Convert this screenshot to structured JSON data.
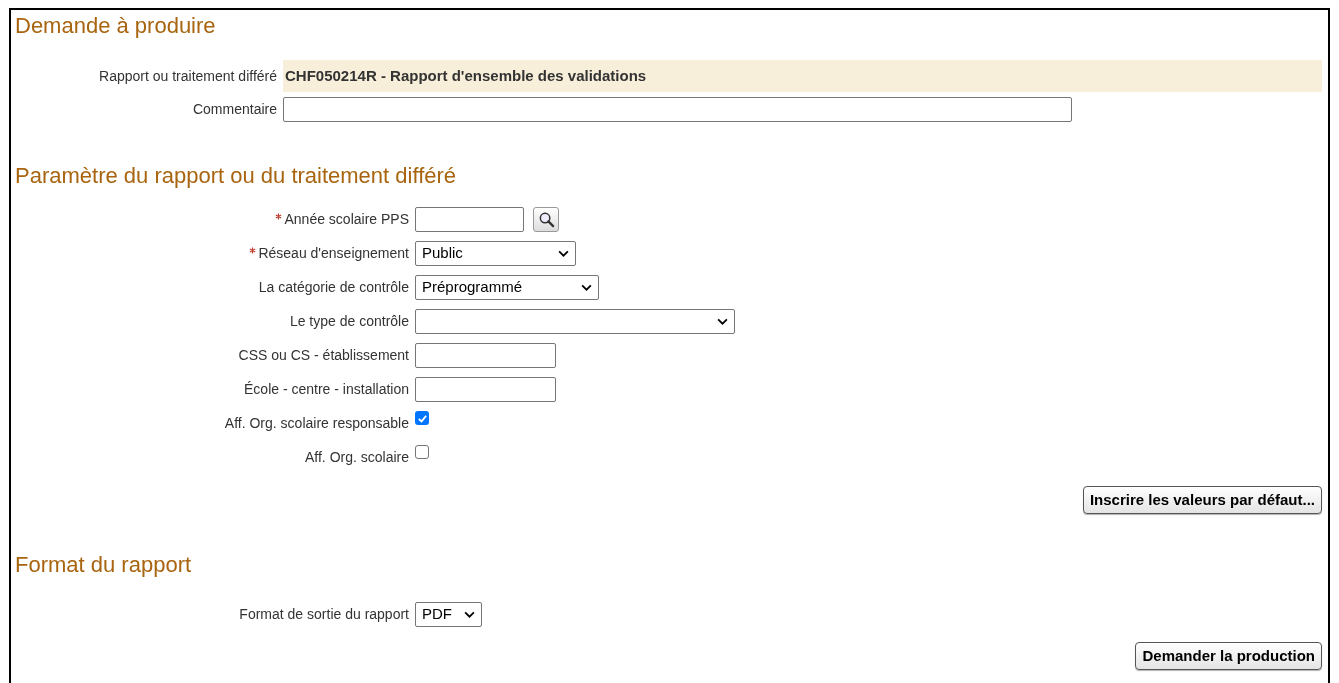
{
  "sections": [
    {
      "title": "Demande à produire",
      "fields": [
        {
          "kind": "readonly",
          "label": "Rapport ou traitement différé",
          "value": "CHF050214R - Rapport d'ensemble des validations"
        },
        {
          "kind": "text",
          "label": "Commentaire"
        }
      ]
    },
    {
      "title": "Paramètre du rapport ou du traitement différé",
      "fields": [
        {
          "kind": "lookup",
          "label": "Année scolaire PPS",
          "required": true
        },
        {
          "kind": "select",
          "label": "Réseau d'enseignement",
          "required": true,
          "value": "Public"
        },
        {
          "kind": "select",
          "label": "La catégorie de contrôle",
          "value": "Préprogrammé"
        },
        {
          "kind": "select",
          "label": "Le type de contrôle"
        },
        {
          "kind": "text",
          "label": "CSS ou CS - établissement"
        },
        {
          "kind": "text",
          "label": "École - centre - installation"
        },
        {
          "kind": "checkbox",
          "label": "Aff. Org. scolaire responsable",
          "checked": true
        },
        {
          "kind": "checkbox",
          "label": "Aff. Org. scolaire",
          "checked": false
        }
      ],
      "button": "Inscrire les valeurs par défaut..."
    },
    {
      "title": "Format du rapport",
      "fields": [
        {
          "kind": "select",
          "label": "Format de sortie du rapport",
          "value": "PDF"
        }
      ],
      "button": "Demander la production"
    }
  ]
}
